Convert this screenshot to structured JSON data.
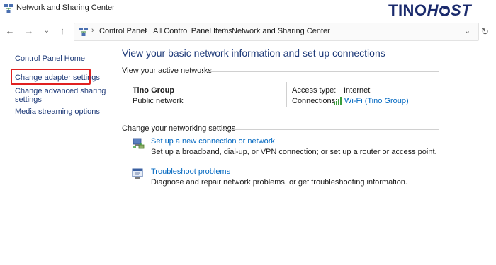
{
  "window": {
    "title": "Network and Sharing Center",
    "title_icon": "network-sharing-icon",
    "brand": {
      "part1": "TINO",
      "part2": "H",
      "part3": "ST",
      "color": "#1a2a6c"
    }
  },
  "nav": {
    "back_icon": "back-arrow-icon",
    "forward_icon": "forward-arrow-icon",
    "recent_icon": "chevron-down-icon",
    "up_icon": "up-arrow-icon",
    "breadcrumb": [
      "Control Panel",
      "All Control Panel Items",
      "Network and Sharing Center"
    ],
    "dropdown_icon": "chevron-down-icon",
    "refresh_icon": "refresh-icon"
  },
  "sidebar": {
    "items": [
      {
        "label": "Control Panel Home"
      },
      {
        "label": "Change adapter settings",
        "highlighted": true
      },
      {
        "label_line1": "Change advanced sharing",
        "label_line2": "settings"
      },
      {
        "label": "Media streaming options"
      }
    ],
    "highlight_color": "#e02020"
  },
  "main": {
    "title": "View your basic network information and set up connections",
    "active_networks_label": "View your active networks",
    "network": {
      "name": "Tino Group",
      "type": "Public network",
      "access_type_label": "Access type:",
      "access_type_value": "Internet",
      "connections_label": "Connections:",
      "connection_name": "Wi-Fi (Tino Group)",
      "connection_icon": "wifi-signal-icon"
    },
    "change_settings_label": "Change your networking settings",
    "tasks": [
      {
        "icon": "new-connection-icon",
        "link": "Set up a new connection or network",
        "description": "Set up a broadband, dial-up, or VPN connection; or set up a router or access point."
      },
      {
        "icon": "troubleshoot-icon",
        "link": "Troubleshoot problems",
        "description": "Diagnose and repair network problems, or get troubleshooting information."
      }
    ]
  },
  "colors": {
    "link": "#0067c0",
    "heading": "#1e3a78"
  }
}
